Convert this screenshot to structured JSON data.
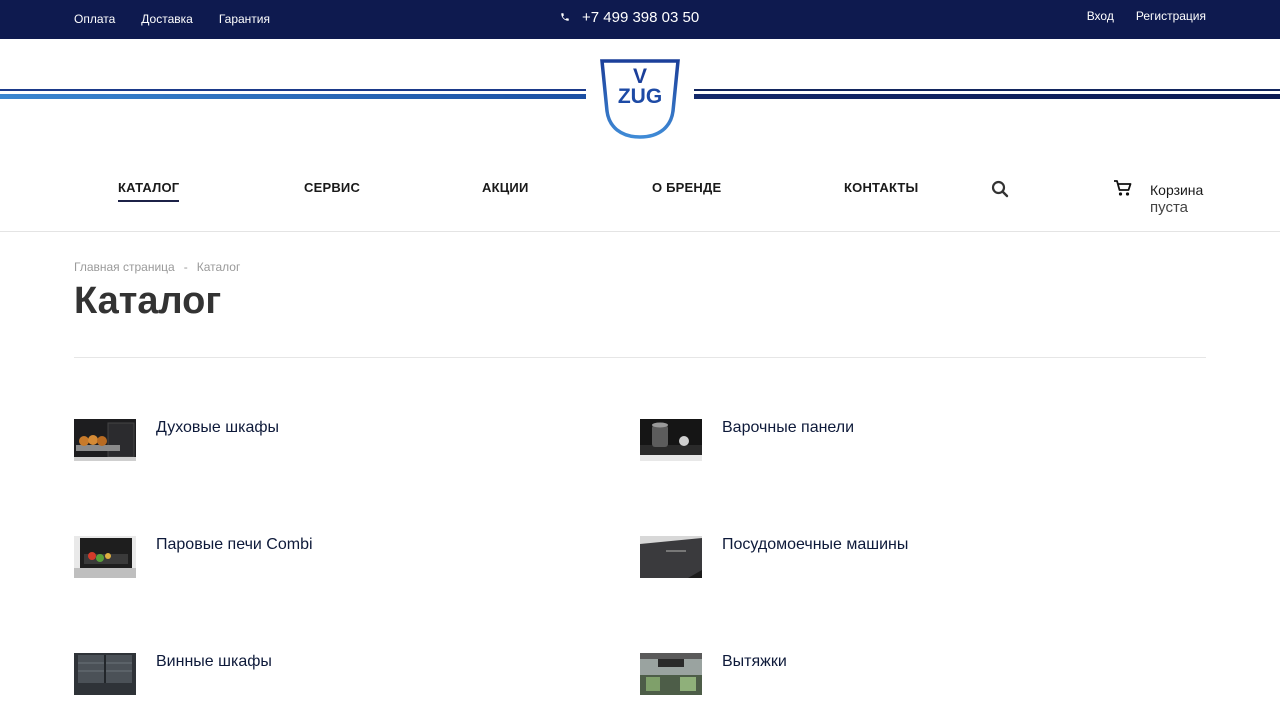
{
  "topbar": {
    "links": [
      "Оплата",
      "Доставка",
      "Гарантия"
    ],
    "phone": "+7 499 398 03 50",
    "login": "Вход",
    "register": "Регистрация"
  },
  "logo": {
    "text_top": "V",
    "text_bottom": "ZUG"
  },
  "nav": {
    "items": [
      "КАТАЛОГ",
      "СЕРВИС",
      "АКЦИИ",
      "О БРЕНДЕ",
      "КОНТАКТЫ"
    ],
    "active": "КАТАЛОГ",
    "cart_label": "Корзина",
    "cart_status": "пуста"
  },
  "breadcrumb": {
    "home": "Главная страница",
    "separator": "-",
    "current": "Каталог"
  },
  "page_title": "Каталог",
  "catalog": {
    "items": [
      {
        "label": "Духовые шкафы",
        "icon": "oven-thumbnail"
      },
      {
        "label": "Варочные панели",
        "icon": "cooktop-thumbnail"
      },
      {
        "label": "Паровые печи Combi",
        "icon": "steam-oven-thumbnail"
      },
      {
        "label": "Посудомоечные машины",
        "icon": "dishwasher-thumbnail"
      },
      {
        "label": "Винные шкафы",
        "icon": "wine-cabinet-thumbnail"
      },
      {
        "label": "Вытяжки",
        "icon": "hood-thumbnail"
      }
    ]
  },
  "colors": {
    "topbar_bg": "#0e1a4f",
    "brand_blue": "#1b4fa3",
    "nav_underline": "#1c2147",
    "title": "#333333"
  }
}
